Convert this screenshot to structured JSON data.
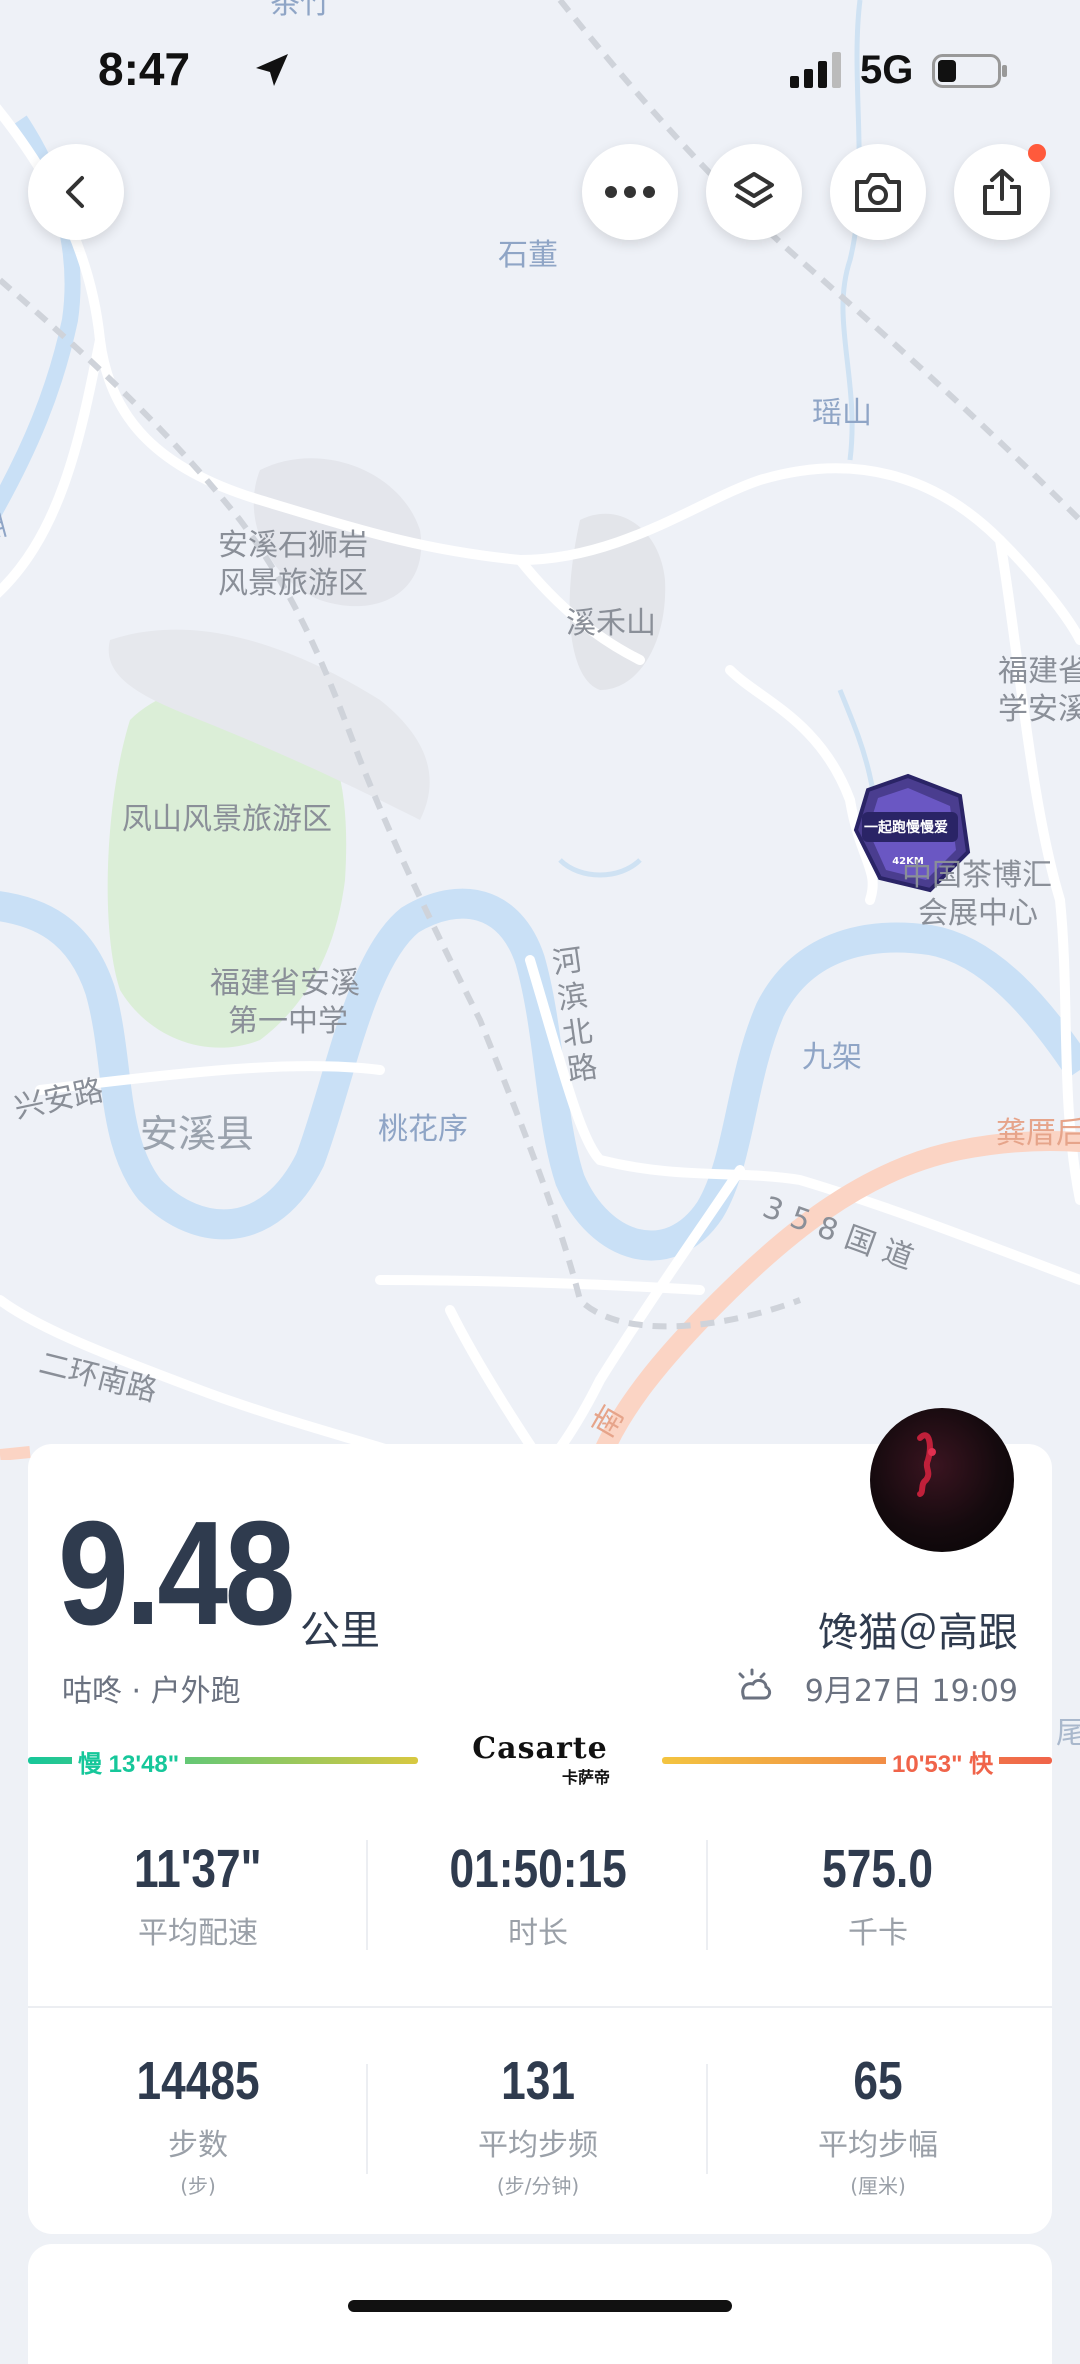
{
  "status_bar": {
    "time": "8:47",
    "network": "5G"
  },
  "toolbar": {
    "back": "chevron-left-icon",
    "more": "more-icon",
    "layers": "layers-icon",
    "camera": "camera-icon",
    "share": "share-icon"
  },
  "map": {
    "labels": {
      "top_partial": "茶竹",
      "shidong": "石董",
      "yaoshan": "瑶山",
      "xi_river": "西溪",
      "shishiyan_1": "安溪石狮岩",
      "shishiyan_2": "风景旅游区",
      "xiheshan": "溪禾山",
      "fujian_partial_1": "福建省",
      "fujian_partial_2": "学安溪",
      "fengshan": "凤山风景旅游区",
      "tea_expo_1": "中国茶博汇",
      "tea_expo_2": "会展中心",
      "school_1": "福建省安溪",
      "school_2": "第一中学",
      "hebin_road": "河滨北路",
      "xingan_road": "兴安路",
      "anxi_county": "安溪县",
      "taohuaxu": "桃花序",
      "jiujia": "九架",
      "gongcuo_partial": "龚厝后",
      "national_road": "358国道",
      "erhuan_road": "二环南路",
      "bottom_partial": "南",
      "wei_partial": "尾"
    },
    "medal_text": "一起跑慢慢爱",
    "medal_sub": "42KM"
  },
  "summary": {
    "distance": "9.48",
    "distance_unit": "公里",
    "sport": "咕咚 · 户外跑",
    "username": "馋猫＠高跟",
    "datetime": "9月27日 19:09"
  },
  "pace_bar": {
    "slow_label": "慢 13'48\"",
    "fast_label": "10'53\" 快",
    "sponsor_en": "Casarte",
    "sponsor_cn": "卡萨帝",
    "colors": {
      "slow": "#16c79a",
      "mid": "#f0c040",
      "fast": "#f0644a"
    }
  },
  "stats": [
    {
      "value": "11'37\"",
      "label": "平均配速",
      "unit": ""
    },
    {
      "value": "01:50:15",
      "label": "时长",
      "unit": ""
    },
    {
      "value": "575.0",
      "label": "千卡",
      "unit": ""
    },
    {
      "value": "14485",
      "label": "步数",
      "unit": "(步)"
    },
    {
      "value": "131",
      "label": "平均步频",
      "unit": "(步/分钟)"
    },
    {
      "value": "65",
      "label": "平均步幅",
      "unit": "(厘米)"
    }
  ]
}
